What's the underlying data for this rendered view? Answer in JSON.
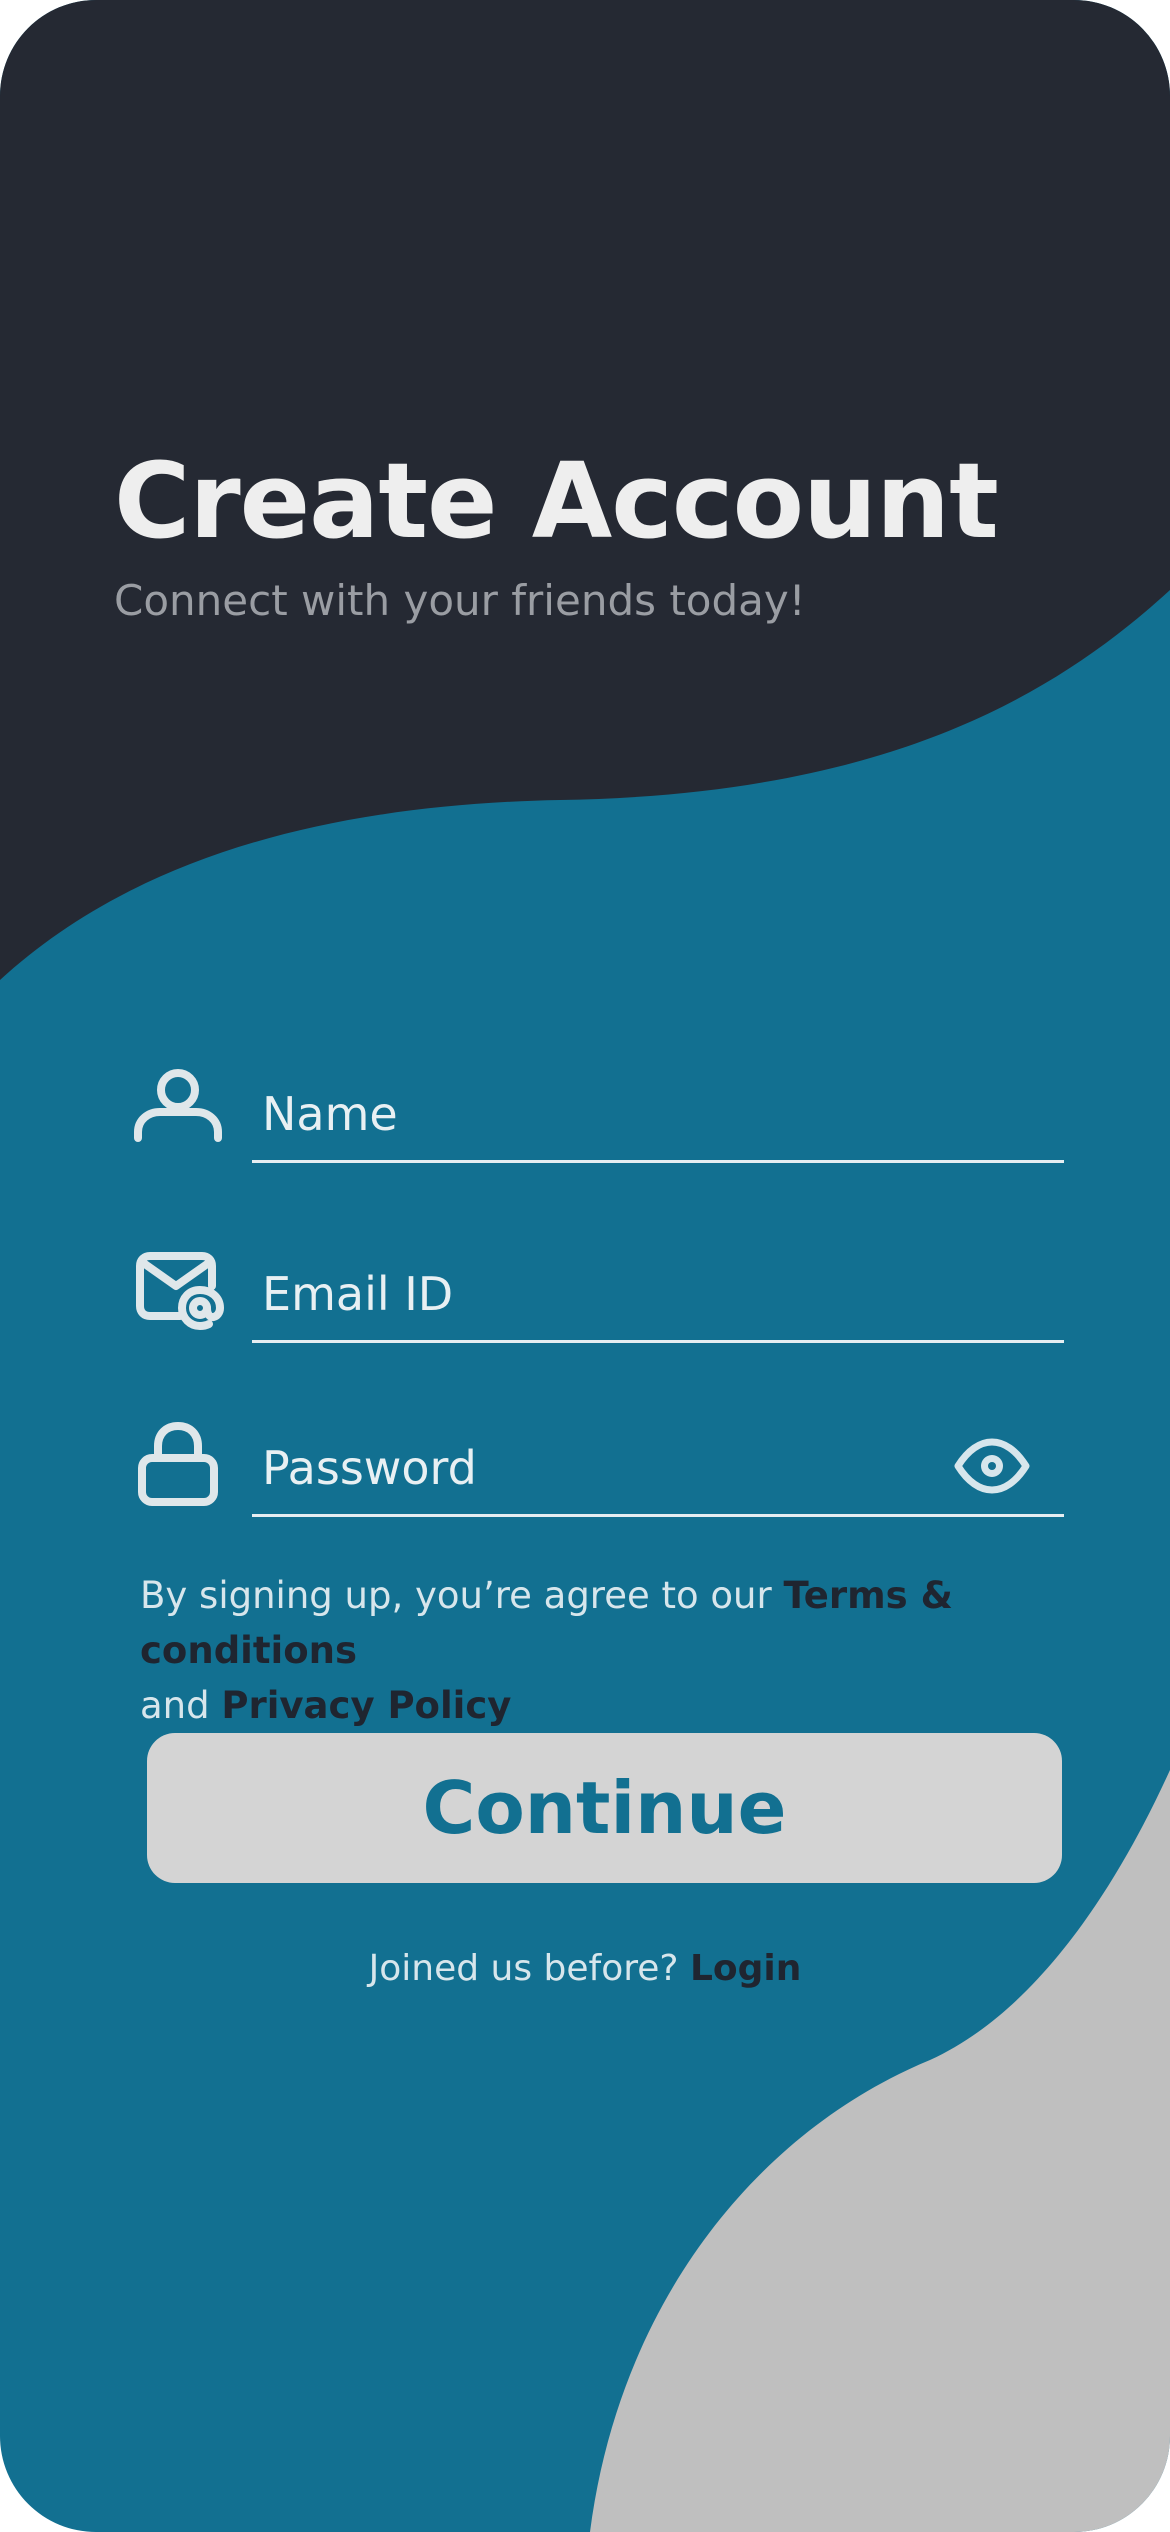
{
  "header": {
    "title": "Create Account",
    "subtitle": "Connect with your friends today!"
  },
  "form": {
    "name_field": {
      "placeholder": "Name",
      "icon": "user-icon"
    },
    "email_field": {
      "placeholder": "Email ID",
      "icon": "mail-at-icon"
    },
    "password_field": {
      "placeholder": "Password",
      "icon": "lock-icon",
      "toggle_icon": "eye-icon"
    }
  },
  "terms": {
    "prefix": "By signing up, you’re agree to our ",
    "terms_link": "Terms & conditions",
    "middle": " and ",
    "privacy_link": "Privacy Policy"
  },
  "continue_button": {
    "label": "Continue"
  },
  "login": {
    "prompt": "Joined us before? ",
    "link": "Login"
  },
  "colors": {
    "header_dark": "#252933",
    "form_blue": "#127091",
    "corner_grey": "#bfbfbf",
    "button_bg": "#d4d4d4",
    "link_dark": "#1f2530",
    "title_text": "#eeeeee",
    "subtitle_text": "#9a9da3"
  }
}
